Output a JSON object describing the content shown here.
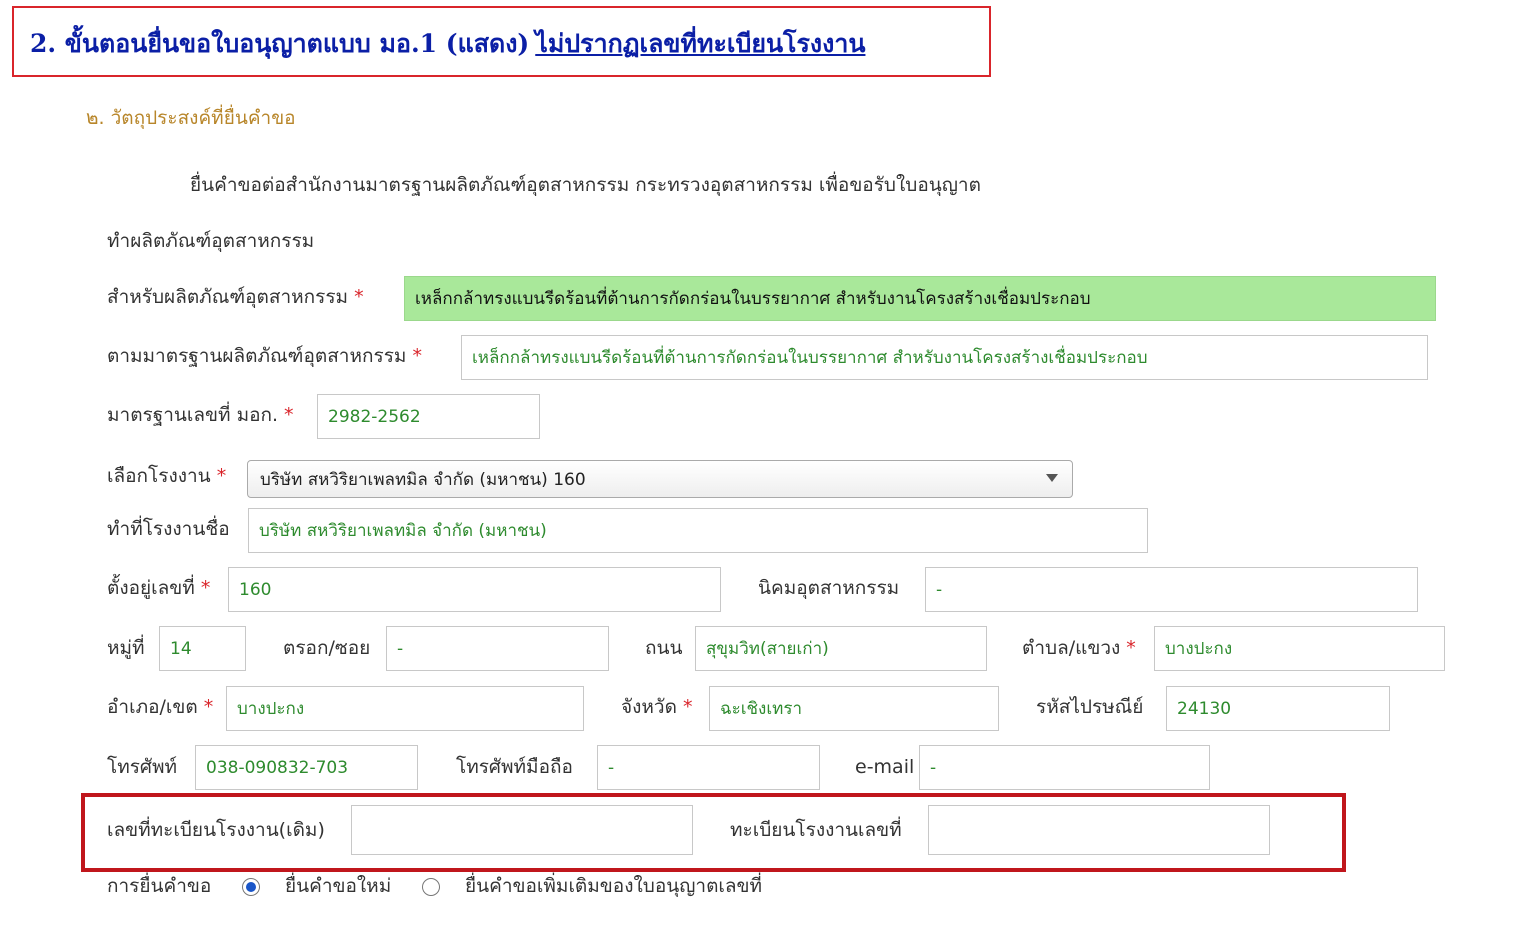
{
  "banner": {
    "title": "2. ขั้นตอนยื่นขอใบอนุญาตแบบ มอ.1 (แสดง)",
    "underlined": "ไม่ปรากฏเลขที่ทะเบียนโรงงาน"
  },
  "section": {
    "title": "๒. วัตถุประสงค์ที่ยื่นคำขอ"
  },
  "intro": {
    "line1": "ยื่นคำขอต่อสำนักงานมาตรฐานผลิตภัณฑ์อุตสาหกรรม กระทรวงอุตสาหกรรม เพื่อขอรับใบอนุญาต",
    "line2": "ทำผลิตภัณฑ์อุตสาหกรรม"
  },
  "required_mark": "*",
  "form": {
    "product_label": "สำหรับผลิตภัณฑ์อุตสาหกรรม",
    "product_value": "เหล็กกล้าทรงแบนรีดร้อนที่ต้านการกัดกร่อนในบรรยากาศ สำหรับงานโครงสร้างเชื่อมประกอบ",
    "standard_label": "ตามมาตรฐานผลิตภัณฑ์อุตสาหกรรม",
    "standard_value": "เหล็กกล้าทรงแบนรีดร้อนที่ต้านการกัดกร่อนในบรรยากาศ สำหรับงานโครงสร้างเชื่อมประกอบ",
    "tis_label": "มาตรฐานเลขที่ มอก.",
    "tis_value": "2982-2562",
    "factory_select_label": "เลือกโรงงาน",
    "factory_select_value": "บริษัท สหวิริยาเพลทมิล จำกัด (มหาชน) 160",
    "factory_name_label": "ทำที่โรงงานชื่อ",
    "factory_name_value": "บริษัท สหวิริยาเพลทมิล จำกัด (มหาชน)",
    "address_no_label": "ตั้งอยู่เลขที่",
    "address_no_value": "160",
    "estate_label": "นิคมอุตสาหกรรม",
    "estate_value": "-",
    "moo_label": "หมู่ที่",
    "moo_value": "14",
    "soi_label": "ตรอก/ซอย",
    "soi_value": "-",
    "road_label": "ถนน",
    "road_value": "สุขุมวิท(สายเก่า)",
    "subdistrict_label": "ตำบล/แขวง",
    "subdistrict_value": "บางปะกง",
    "district_label": "อำเภอ/เขต",
    "district_value": "บางปะกง",
    "province_label": "จังหวัด",
    "province_value": "ฉะเชิงเทรา",
    "postcode_label": "รหัสไปรษณีย์",
    "postcode_value": "24130",
    "phone_label": "โทรศัพท์",
    "phone_value": "038-090832-703",
    "mobile_label": "โทรศัพท์มือถือ",
    "mobile_value": "-",
    "email_label": "e-mail",
    "email_value": "-",
    "old_reg_label": "เลขที่ทะเบียนโรงงาน(เดิม)",
    "old_reg_value": "",
    "reg_label": "ทะเบียนโรงงานเลขที่",
    "reg_value": "",
    "request_label": "การยื่นคำขอ",
    "request_new_label": "ยื่นคำขอใหม่",
    "request_add_label": "ยื่นคำขอเพิ่มเติมของใบอนุญาตเลขที่"
  }
}
